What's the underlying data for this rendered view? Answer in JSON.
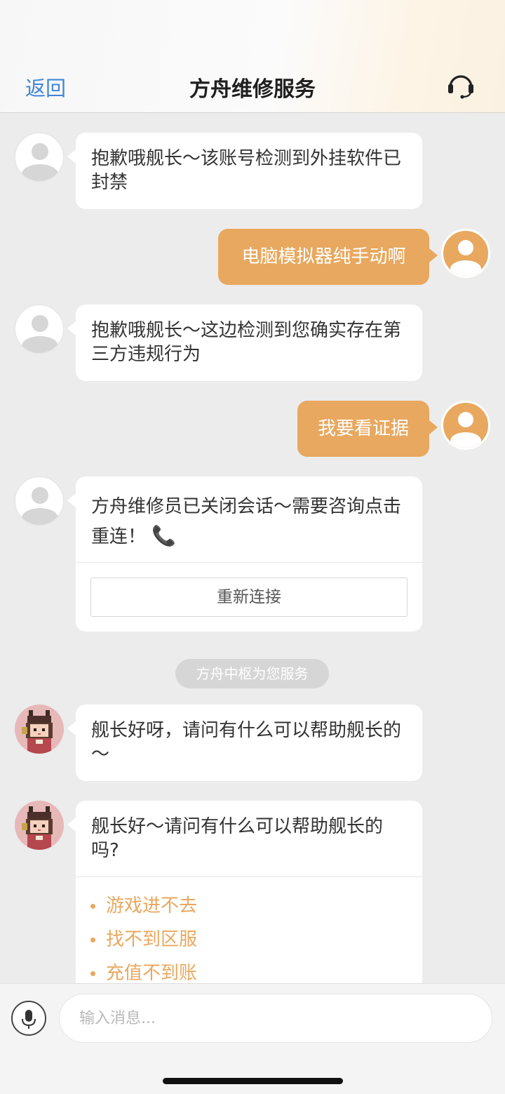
{
  "header": {
    "back_label": "返回",
    "title": "方舟维修服务",
    "support_icon": "headset-icon"
  },
  "messages": [
    {
      "from": "agent",
      "text": "抱歉哦舰长～该账号检测到外挂软件已封禁"
    },
    {
      "from": "user",
      "text": "电脑模拟器纯手动啊"
    },
    {
      "from": "agent",
      "text": "抱歉哦舰长～这边检测到您确实存在第三方违规行为"
    },
    {
      "from": "user",
      "text": "我要看证据"
    },
    {
      "from": "agent",
      "text": "方舟维修员已关闭会话～需要咨询点击重连！",
      "emoji": "📞",
      "action_label": "重新连接"
    },
    {
      "from": "bot",
      "text": "舰长好呀，请问有什么可以帮助舰长的～"
    },
    {
      "from": "bot",
      "text": "舰长好～请问有什么可以帮助舰长的吗?",
      "quick_replies": [
        "游戏进不去",
        "找不到区服",
        "充值不到账"
      ]
    }
  ],
  "system_notice": "方舟中枢为您服务",
  "input": {
    "placeholder": "输入消息...",
    "value": "",
    "mic_icon": "microphone-icon"
  },
  "colors": {
    "accent": "#e8a85f",
    "link": "#3f86d6",
    "background": "#ececec"
  }
}
